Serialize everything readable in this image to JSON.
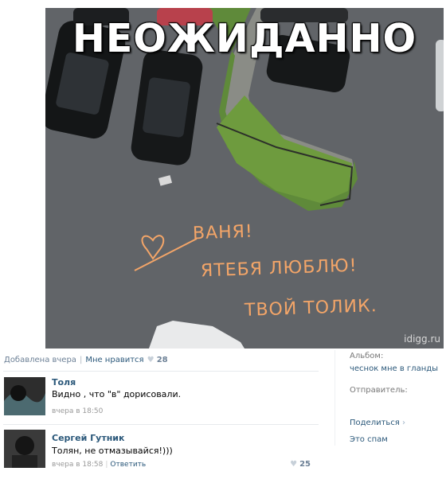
{
  "photo": {
    "caption": "НЕОЖИДАННО",
    "chalk_line1": "ВАНЯ!",
    "chalk_line2": "ЯТЕБЯ ЛЮБЛЮ!",
    "chalk_line3": "ТВОЙ ТОЛИК.",
    "watermark": "idigg.ru"
  },
  "meta": {
    "added": "Добавлена вчера",
    "like_label": "Мне нравится",
    "likes": "28"
  },
  "comments": [
    {
      "author": "Толя",
      "text": "Видно , что \"в\" дорисовали.",
      "time": "вчера в 18:50"
    },
    {
      "author": "Сергей Гутник",
      "text": "Толян, не отмазывайся!)))",
      "time": "вчера в 18:58",
      "reply": "Ответить",
      "likes": "25"
    }
  ],
  "sidebar": {
    "album_label": "Альбом:",
    "album_name": "чеснок мне в гланды",
    "sender_label": "Отправитель:",
    "share": "Поделиться",
    "spam": "Это спам"
  }
}
